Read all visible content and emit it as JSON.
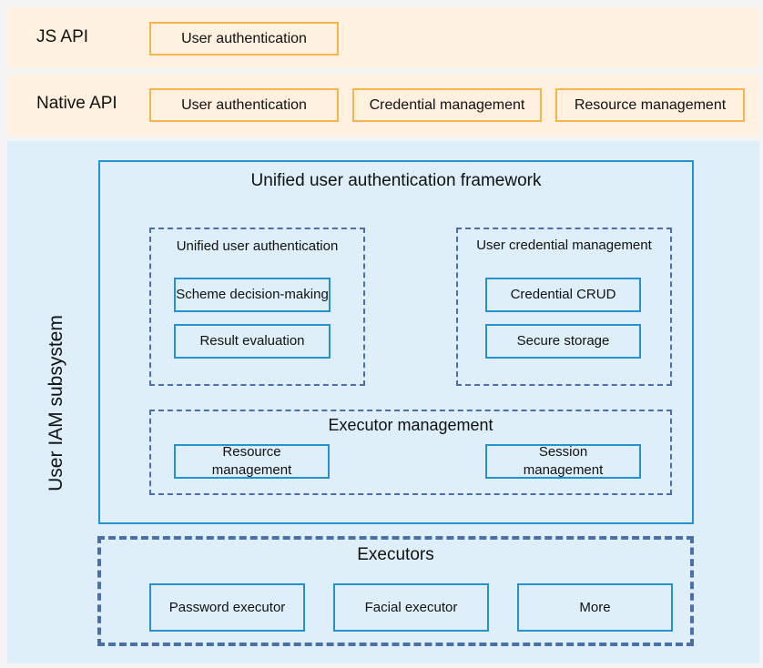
{
  "js_api": {
    "label": "JS API",
    "boxes": [
      "User authentication"
    ]
  },
  "native_api": {
    "label": "Native API",
    "boxes": [
      "User authentication",
      "Credential management",
      "Resource management"
    ]
  },
  "subsystem": {
    "label": "User IAM subsystem",
    "framework": {
      "title": "Unified user authentication framework",
      "unified_auth": {
        "title": "Unified user authentication",
        "items": [
          "Scheme decision-making",
          "Result evaluation"
        ]
      },
      "credential_mgmt": {
        "title": "User credential management",
        "items": [
          "Credential CRUD",
          "Secure storage"
        ]
      },
      "executor_mgmt": {
        "title": "Executor management",
        "items": [
          "Resource management",
          "Session management"
        ]
      }
    },
    "executors": {
      "title": "Executors",
      "items": [
        "Password executor",
        "Facial executor",
        "More"
      ]
    }
  },
  "colors": {
    "api_band": "#fff0df",
    "api_border": "#f7b44a",
    "subsystem_bg": "#dfeff9",
    "box_border": "#2491d0",
    "dash_border": "#4a6fab"
  }
}
